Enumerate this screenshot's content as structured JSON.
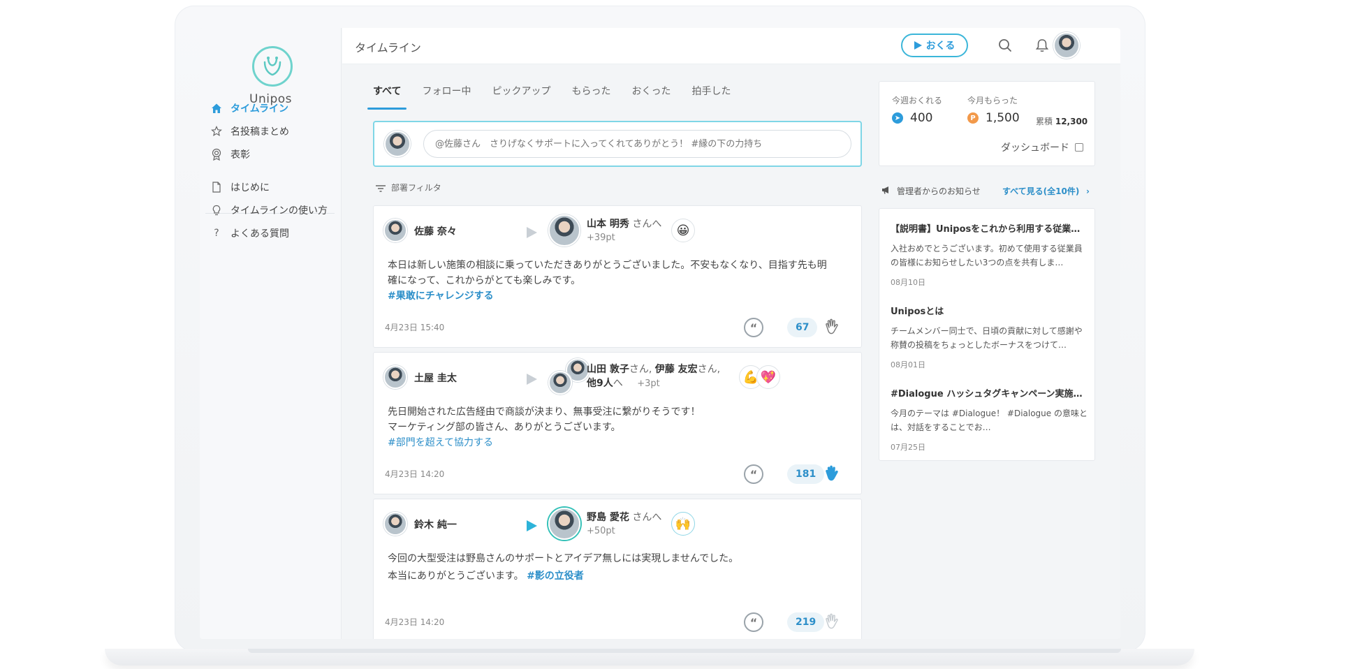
{
  "app": {
    "brand": "Unipos"
  },
  "sidebar": {
    "items": [
      {
        "label": "タイムライン"
      },
      {
        "label": "名投稿まとめ"
      },
      {
        "label": "表彰"
      },
      {
        "label": "はじめに"
      },
      {
        "label": "タイムラインの使い方"
      },
      {
        "label": "よくある質問"
      }
    ]
  },
  "header": {
    "title": "タイムライン",
    "send_label": "おくる"
  },
  "tabs": [
    {
      "label": "すべて"
    },
    {
      "label": "フォロー中"
    },
    {
      "label": "ピックアップ"
    },
    {
      "label": "もらった"
    },
    {
      "label": "おくった"
    },
    {
      "label": "拍手した"
    }
  ],
  "composer": {
    "placeholder": "@佐藤さん　さりげなくサポートに入ってくれてありがとう！ #縁の下の力持ち"
  },
  "filter": {
    "label": "部署フィルタ"
  },
  "posts": [
    {
      "author": "佐藤 奈々",
      "recipient": "山本 明秀",
      "recipient_suffix": "さんへ",
      "points": "+39pt",
      "stamp": "😀",
      "line1": "本日は新しい施策の相談に乗っていただきありがとうございました。不安もなくなり、目指す先も明",
      "line2": "確になって、これからがとても楽しみです。",
      "hashtag": "#果敢にチャレンジする",
      "time": "4月23日 15:40",
      "claps": "67"
    },
    {
      "author": "土屋 圭太",
      "recipient_a": "山田 敦子",
      "recipient_a_suffix": "さん,",
      "recipient_b": "伊藤 友宏",
      "recipient_b_suffix": "さん,",
      "recipient_more": "他9人",
      "recipient_more_suffix": "へ",
      "points": "+3pt",
      "stamp_a": "💪",
      "stamp_b": "💖",
      "line1": "先日開始された広告経由で商談が決まり、無事受注に繋がりそうです！",
      "line2": "マーケティング部の皆さん、ありがとうございます。",
      "hashtag": "#部門を超えて協力する",
      "time": "4月23日 14:20",
      "claps": "181"
    },
    {
      "author": "鈴木 純一",
      "recipient": "野島 愛花",
      "recipient_suffix": "さんへ",
      "points": "+50pt",
      "stamp": "🙌",
      "line1": "今回の大型受注は野島さんのサポートとアイデア無しには実現しませんでした。",
      "line2": "本当にありがとうございます。",
      "hashtag": "#影の立役者",
      "time": "4月23日 14:20",
      "claps": "219"
    }
  ],
  "stats": {
    "weekly_label": "今週おくれる",
    "weekly_value": "400",
    "monthly_label": "今月もらった",
    "monthly_value": "1,500",
    "cumulative_label": "累積",
    "cumulative_value": "12,300",
    "dashboard_label": "ダッシュボード"
  },
  "notices_head": {
    "label": "管理者からのお知らせ",
    "see_all": "すべて見る(全10件)"
  },
  "notices": [
    {
      "title": "【説明書】Uniposをこれから利用する従業員へ",
      "text": "入社おめでとうございます。初めて使用する従業員の皆様にお知らせしたい3つの点を共有しま…",
      "date": "08月10日"
    },
    {
      "title": "Uniposとは",
      "text": "チームメンバー同士で、日頃の貢献に対して感謝や称賛の投稿をちょっとしたボーナスをつけて…",
      "date": "08月01日"
    },
    {
      "title": "#Dialogue ハッシュタグキャンペーン実施中！",
      "text": "今月のテーマは #Dialogue！ #Dialogue の意味とは、対話をすることでお…",
      "date": "07月25日"
    }
  ],
  "colors": {
    "accent": "#2d9cdb",
    "teal": "#35c1b8",
    "coin_blue": "#2d9cdb",
    "coin_orange": "#f2994a"
  }
}
